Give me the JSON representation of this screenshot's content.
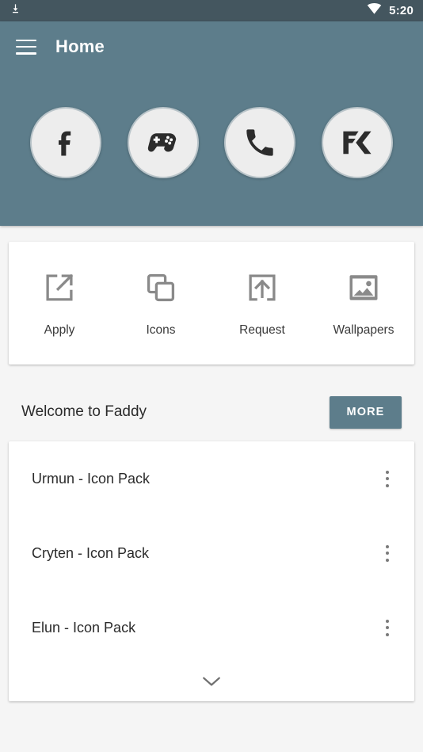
{
  "statusbar": {
    "download_icon": "download-icon",
    "wifi_icon": "wifi-icon",
    "time": "5:20"
  },
  "appbar": {
    "menu_icon": "hamburger-menu-icon",
    "title": "Home"
  },
  "theme": {
    "primary": "#5D7D8B",
    "primary_dark": "#44565F",
    "page_background": "#F5F5F5",
    "card_background": "#FFFFFF",
    "circle_fill": "#EDEDED",
    "circle_border": "#B9C4C9",
    "icon_gray": "#8A8A8A",
    "text_primary": "#2B2B2B"
  },
  "shortcuts": [
    {
      "name": "facebook",
      "icon": "facebook-icon"
    },
    {
      "name": "games",
      "icon": "game-controller-icon"
    },
    {
      "name": "phone",
      "icon": "phone-icon"
    },
    {
      "name": "fk",
      "icon": "fk-logo-icon"
    }
  ],
  "actions": [
    {
      "label": "Apply",
      "icon": "open-in-new-icon"
    },
    {
      "label": "Icons",
      "icon": "copy-layers-icon"
    },
    {
      "label": "Request",
      "icon": "upload-box-icon"
    },
    {
      "label": "Wallpapers",
      "icon": "image-icon"
    }
  ],
  "welcome": {
    "title": "Welcome to Faddy",
    "more_label": "MORE"
  },
  "icon_packs": {
    "items": [
      {
        "label": "Urmun - Icon Pack",
        "overflow_icon": "kebab-menu-icon"
      },
      {
        "label": "Cryten - Icon Pack",
        "overflow_icon": "kebab-menu-icon"
      },
      {
        "label": "Elun - Icon Pack",
        "overflow_icon": "kebab-menu-icon"
      }
    ],
    "expand_icon": "chevron-down-icon"
  }
}
